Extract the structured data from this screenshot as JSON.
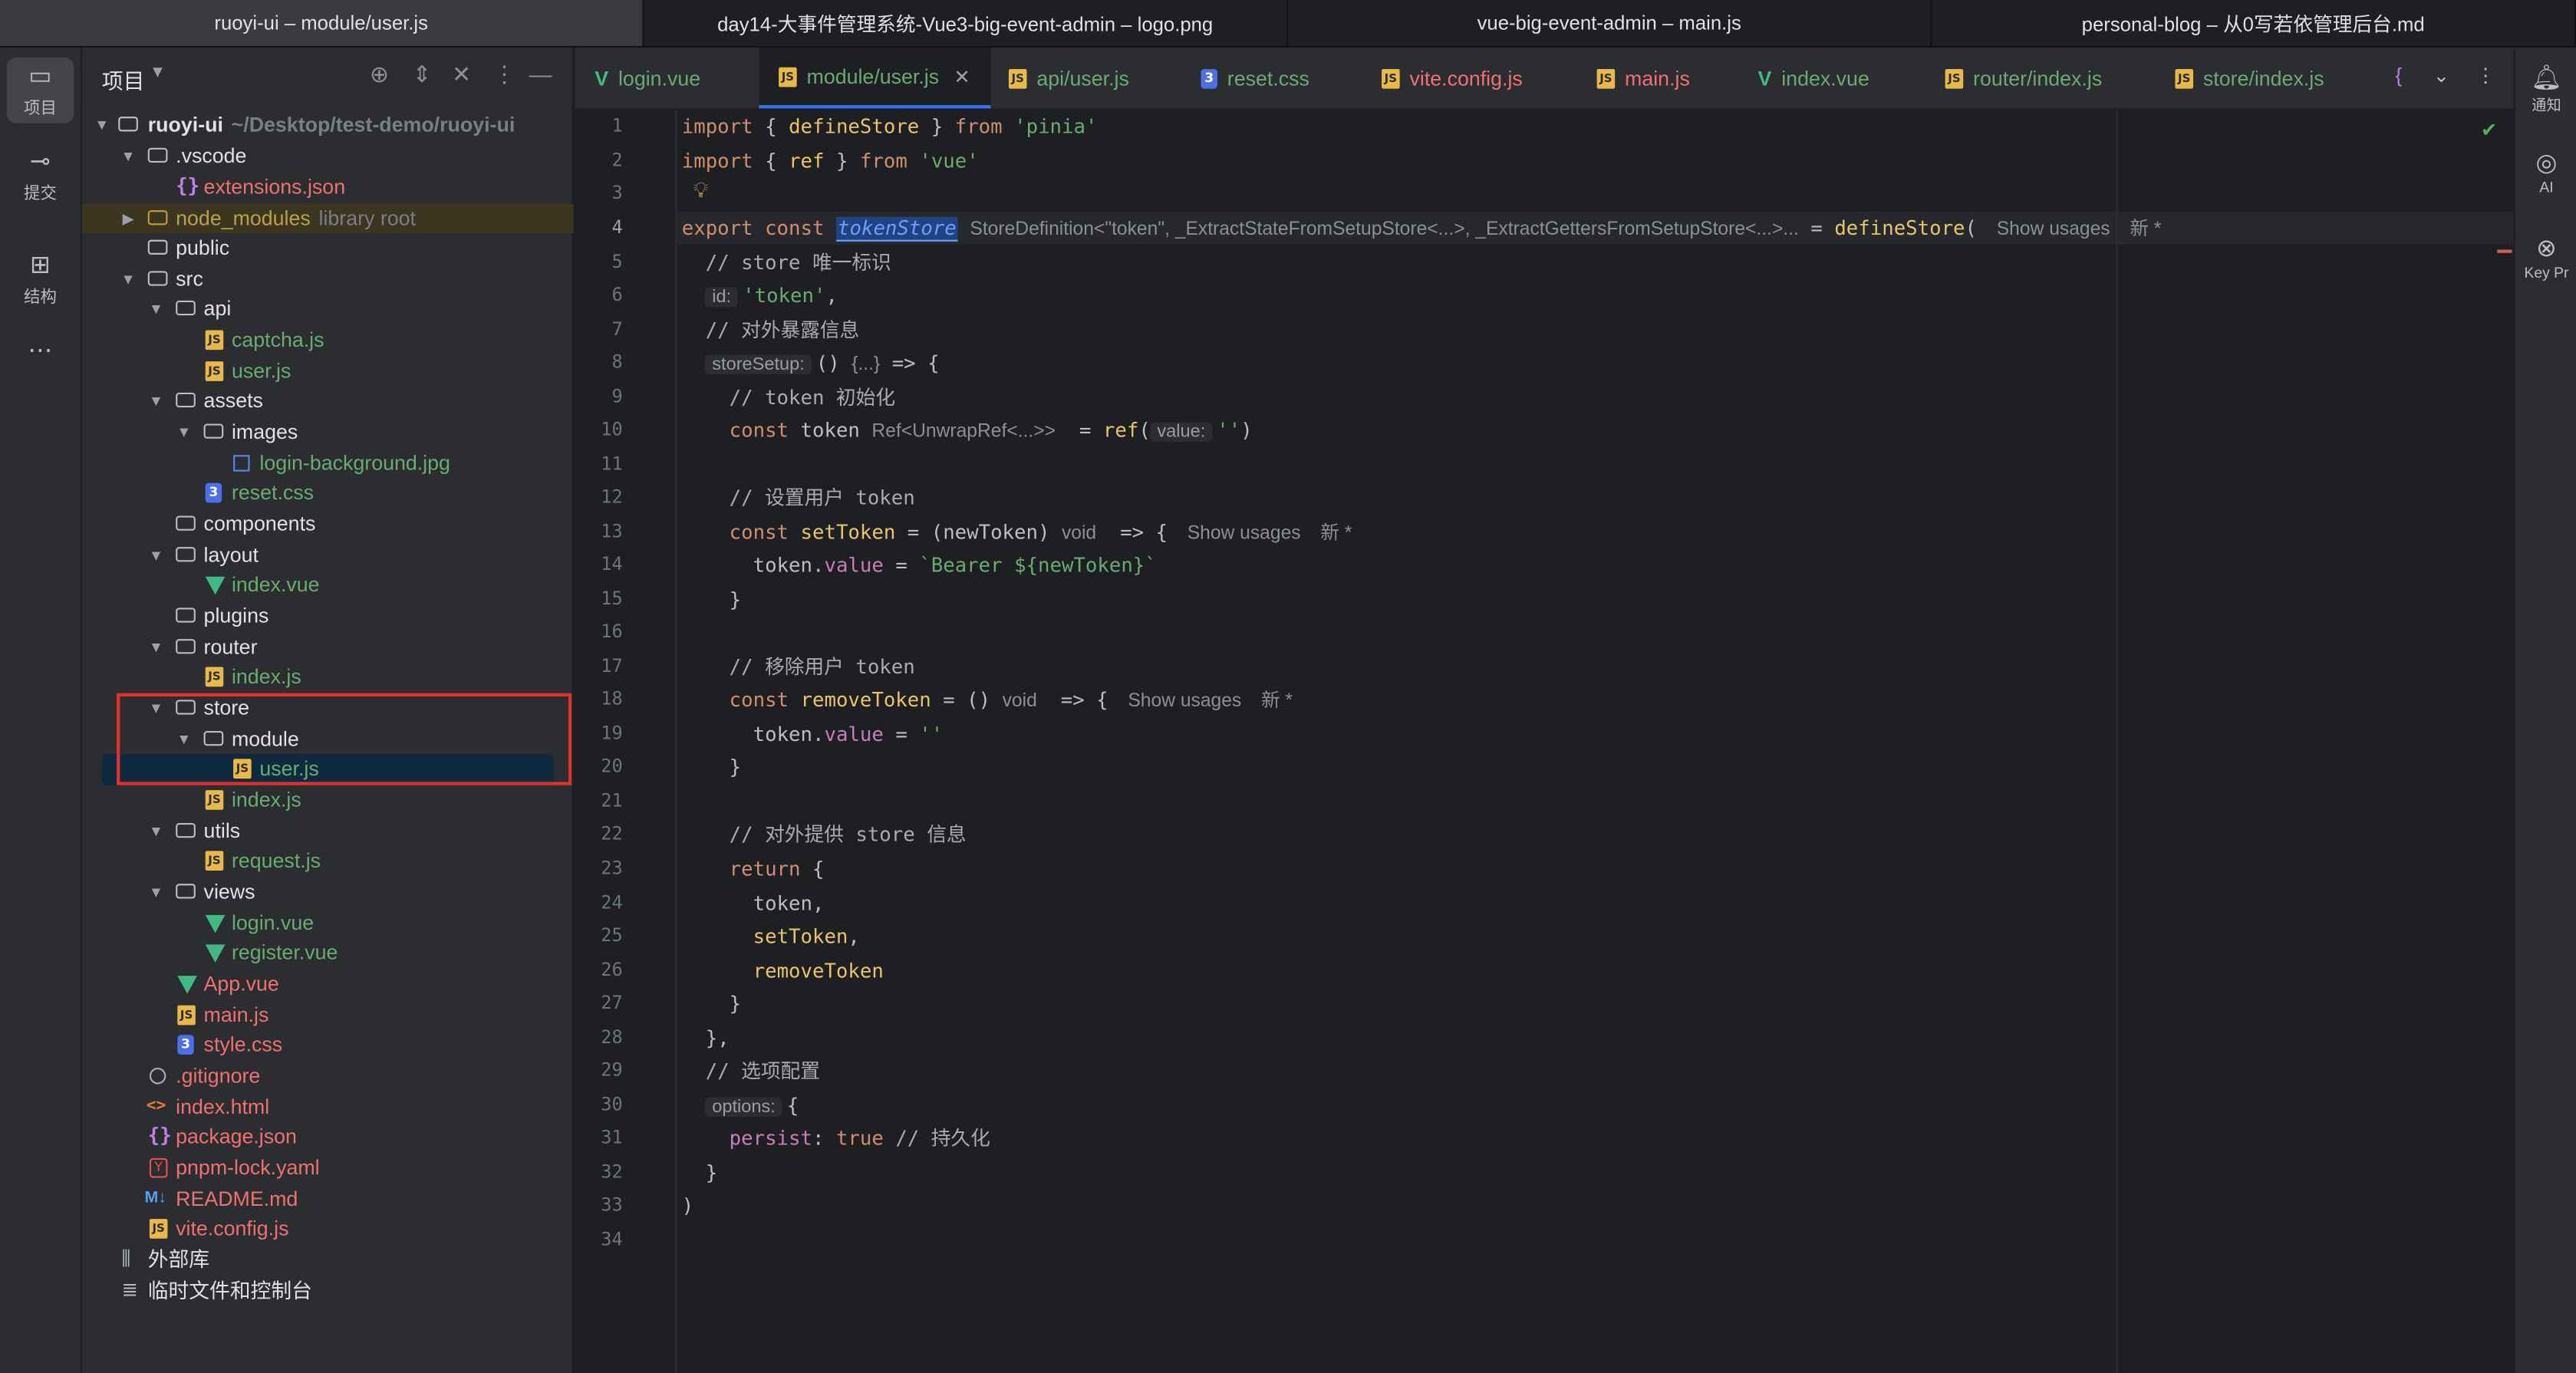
{
  "window_tabs": [
    "ruoyi-ui – module/user.js",
    "day14-大事件管理系统-Vue3-big-event-admin – logo.png",
    "vue-big-event-admin – main.js",
    "personal-blog – 从0写若依管理后台.md"
  ],
  "left_rail": {
    "project": "项目",
    "commit": "提交",
    "structure": "结构",
    "more": "⋯"
  },
  "right_rail": {
    "notifications": "通知",
    "ai": "AI",
    "key_promoter": "Key Pr"
  },
  "project_panel": {
    "title": "项目"
  },
  "tree": [
    {
      "label": "ruoyi-ui",
      "hint": "~/Desktop/test-demo/ruoyi-ui"
    },
    {
      "label": ".vscode"
    },
    {
      "label": "extensions.json"
    },
    {
      "label": "node_modules",
      "hint": "library root"
    },
    {
      "label": "public"
    },
    {
      "label": "src"
    },
    {
      "label": "api"
    },
    {
      "label": "captcha.js"
    },
    {
      "label": "user.js"
    },
    {
      "label": "assets"
    },
    {
      "label": "images"
    },
    {
      "label": "login-background.jpg"
    },
    {
      "label": "reset.css"
    },
    {
      "label": "components"
    },
    {
      "label": "layout"
    },
    {
      "label": "index.vue"
    },
    {
      "label": "plugins"
    },
    {
      "label": "router"
    },
    {
      "label": "index.js"
    },
    {
      "label": "store"
    },
    {
      "label": "module"
    },
    {
      "label": "user.js"
    },
    {
      "label": "index.js"
    },
    {
      "label": "utils"
    },
    {
      "label": "request.js"
    },
    {
      "label": "views"
    },
    {
      "label": "login.vue"
    },
    {
      "label": "register.vue"
    },
    {
      "label": "App.vue"
    },
    {
      "label": "main.js"
    },
    {
      "label": "style.css"
    },
    {
      "label": ".gitignore"
    },
    {
      "label": "index.html"
    },
    {
      "label": "package.json"
    },
    {
      "label": "pnpm-lock.yaml"
    },
    {
      "label": "README.md"
    },
    {
      "label": "vite.config.js"
    },
    {
      "label": "外部库"
    },
    {
      "label": "临时文件和控制台"
    }
  ],
  "editor_tabs": [
    "login.vue",
    "module/user.js",
    "api/user.js",
    "reset.css",
    "vite.config.js",
    "main.js",
    "index.vue",
    "router/index.js",
    "store/index.js"
  ],
  "code": {
    "line_numbers": [
      "1",
      "2",
      "3",
      "4",
      "5",
      "6",
      "7",
      "8",
      "9",
      "10",
      "11",
      "12",
      "13",
      "14",
      "15",
      "16",
      "17",
      "18",
      "19",
      "20",
      "21",
      "22",
      "23",
      "24",
      "25",
      "26",
      "27",
      "28",
      "29",
      "30",
      "31",
      "32",
      "33",
      "34"
    ],
    "l1": {
      "kw1": "import",
      "p1": " { ",
      "fn": "defineStore",
      "p2": " } ",
      "kw2": "from",
      "s": "'pinia'"
    },
    "l2": {
      "kw1": "import",
      "p1": " { ",
      "fn": "ref",
      "p2": " } ",
      "kw2": "from",
      "s": "'vue'"
    },
    "l4": {
      "kw": "export const ",
      "name": "tokenStore",
      "type": "StoreDefinition<\"token\", _ExtractStateFromSetupStore<...>, _ExtractGettersFromSetupStore<...>...",
      "eq": " = ",
      "fn": "defineStore",
      "paren": "(",
      "usage": "Show usages",
      "new": "新 *"
    },
    "l5": {
      "cm": "// store 唯一标识"
    },
    "l6": {
      "hint": "id:",
      "s": "'token'",
      "p": ","
    },
    "l7": {
      "cm": "// 对外暴露信息"
    },
    "l8": {
      "hint": "storeSetup:",
      "p1": "() ",
      "type": "{...}",
      "p2": " => {"
    },
    "l9": {
      "cm": "// token 初始化"
    },
    "l10": {
      "kw": "const ",
      "name": "token",
      "type": "Ref<UnwrapRef<...>>",
      "eq": "  = ",
      "fn": "ref",
      "paren": "(",
      "hint": "value:",
      "s": "''",
      "close": ")"
    },
    "l12": {
      "cm": "// 设置用户 token"
    },
    "l13": {
      "kw": "const ",
      "fn": "setToken",
      "p": " = (newToken)",
      "type": "void",
      "arrow": "  => {",
      "usage": "Show usages",
      "new": "新 *"
    },
    "l14": {
      "a": "token.",
      "prop": "value",
      "b": " = ",
      "s": "`Bearer ${newToken}`"
    },
    "l15": {
      "p": "}"
    },
    "l17": {
      "cm": "// 移除用户 token"
    },
    "l18": {
      "kw": "const ",
      "fn": "removeToken",
      "p": " = ()",
      "type": "void",
      "arrow": "  => {",
      "usage": "Show usages",
      "new": "新 *"
    },
    "l19": {
      "a": "token.",
      "prop": "value",
      "b": " = ",
      "s": "''"
    },
    "l20": {
      "p": "}"
    },
    "l22": {
      "cm": "// 对外提供 store 信息"
    },
    "l23": {
      "kw": "return",
      "p": " {"
    },
    "l24": {
      "p": "token,"
    },
    "l25": {
      "fn": "setToken",
      "p": ","
    },
    "l26": {
      "fn": "removeToken"
    },
    "l27": {
      "p": "}"
    },
    "l28": {
      "p": "},"
    },
    "l29": {
      "cm": "// 选项配置"
    },
    "l30": {
      "hint": "options:",
      "p": "{"
    },
    "l31": {
      "prop": "persist",
      "p": ": ",
      "kw": "true",
      "cm": " // 持久化"
    },
    "l32": {
      "p": "}"
    },
    "l33": {
      "p": ")"
    }
  },
  "colors": {
    "accent": "#3574f0",
    "highlight_box": "#e03131",
    "selection": "#0f2a3f"
  }
}
